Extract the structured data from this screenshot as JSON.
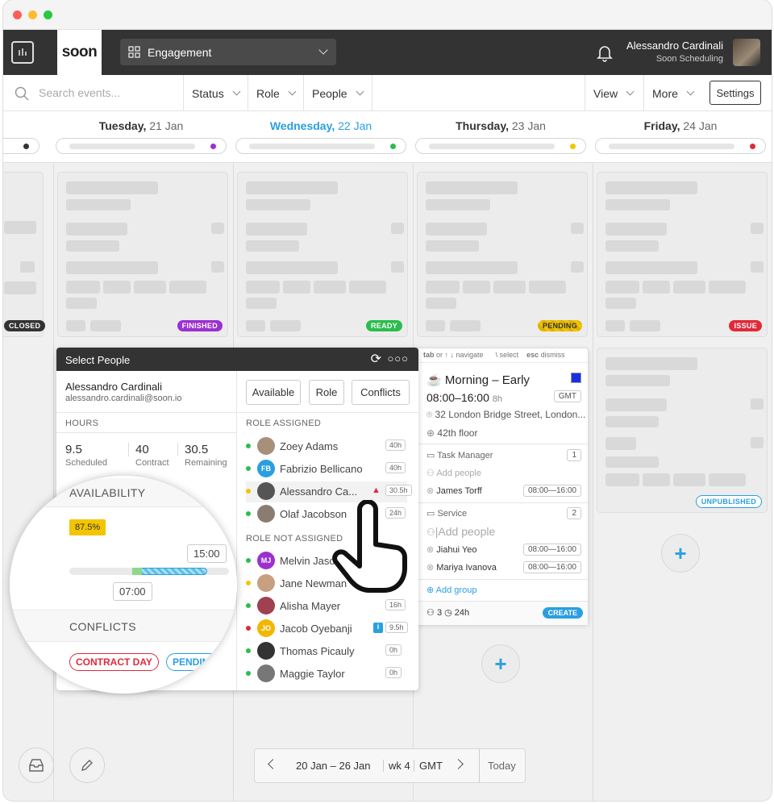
{
  "app": {
    "logo": "soon",
    "workspace": "Engagement",
    "user_name": "Alessandro Cardinali",
    "user_sub": "Soon Scheduling"
  },
  "filters": {
    "search_placeholder": "Search events...",
    "status": "Status",
    "role": "Role",
    "people": "People",
    "view": "View",
    "more": "More",
    "settings": "Settings"
  },
  "days": [
    {
      "name": "Tuesday,",
      "date": "21 Jan",
      "dot": "#9b30d0"
    },
    {
      "name": "Wednesday,",
      "date": "22 Jan",
      "dot": "#2bbd4e"
    },
    {
      "name": "Thursday,",
      "date": "23 Jan",
      "dot": "#f2c500"
    },
    {
      "name": "Friday,",
      "date": "24 Jan",
      "dot": "#e02a3a"
    }
  ],
  "badges": {
    "closed": "CLOSED",
    "finished": "FINISHED",
    "ready": "READY",
    "pending": "PENDING",
    "issue": "ISSUE",
    "unpublished": "UNPUBLISHED"
  },
  "event": {
    "hint_tab": "tab",
    "hint_or": "or ↑ ↓ navigate",
    "hint_select": "\\ select",
    "hint_esc": "esc",
    "hint_dismiss": "dismiss",
    "title": "Morning – Early",
    "time": "08:00–16:00",
    "duration": "8h",
    "tz": "GMT",
    "address": "32 London Bridge Street, London...",
    "floor": "42th floor",
    "group1": {
      "name": "Task Manager",
      "count": "1",
      "add": "Add people",
      "person": "James Torff",
      "time": "08:00—16:00"
    },
    "group2": {
      "name": "Service",
      "count": "2",
      "add": "Add people",
      "p1": "Jiahui Yeo",
      "t1": "08:00—16:00",
      "p2": "Mariya Ivanova",
      "t2": "08:00—16:00"
    },
    "add_group": "Add group",
    "people_count": "3",
    "hours": "24h",
    "create": "CREATE"
  },
  "select_people": {
    "title": "Select People",
    "name": "Alessandro Cardinali",
    "email": "alessandro.cardinali@soon.io",
    "hours_label": "HOURS",
    "scheduled": "9.5",
    "scheduled_label": "Scheduled",
    "contract": "40",
    "contract_label": "Contract",
    "remaining": "30.5",
    "remaining_label": "Remaining",
    "availability_label": "AVAILABILITY",
    "availability_pct": "87.5%",
    "avail_fraction": 0.875,
    "time_end": "15:00",
    "time_start": "07:00",
    "conflicts_label": "CONFLICTS",
    "conflict1": "CONTRACT DAY",
    "conflict2": "PENDING",
    "btn_available": "Available",
    "btn_role": "Role",
    "btn_conflicts": "Conflicts",
    "role_assigned": "ROLE ASSIGNED",
    "role_not_assigned": "ROLE NOT ASSIGNED",
    "assigned": [
      {
        "name": "Zoey Adams",
        "hours": "40h",
        "dot": "#2bbd4e",
        "av": "",
        "avc": "#a88f7a"
      },
      {
        "name": "Fabrizio Bellicano",
        "hours": "40h",
        "dot": "#2bbd4e",
        "av": "FB",
        "avc": "#2a9fe0"
      },
      {
        "name": "Alessandro Ca...",
        "hours": "30.5h",
        "dot": "#f2c500",
        "av": "",
        "avc": "#555"
      },
      {
        "name": "Olaf Jacobson",
        "hours": "24h",
        "dot": "#2bbd4e",
        "av": "",
        "avc": "#8a7c70"
      }
    ],
    "not_assigned": [
      {
        "name": "Melvin Jaso",
        "hours": "",
        "dot": "#2bbd4e",
        "av": "MJ",
        "avc": "#9b30d0"
      },
      {
        "name": "Jane Newman",
        "hours": "",
        "dot": "#f2c500",
        "av": "",
        "avc": "#c8a080"
      },
      {
        "name": "Alisha Mayer",
        "hours": "16h",
        "dot": "#2bbd4e",
        "av": "",
        "avc": "#a04050"
      },
      {
        "name": "Jacob Oyebanji",
        "hours": "9.5h",
        "dot": "#e02a3a",
        "av": "JO",
        "avc": "#f2b800"
      },
      {
        "name": "Thomas Picauly",
        "hours": "0h",
        "dot": "#2bbd4e",
        "av": "",
        "avc": "#333"
      },
      {
        "name": "Maggie Taylor",
        "hours": "0h",
        "dot": "#2bbd4e",
        "av": "",
        "avc": "#777"
      }
    ]
  },
  "nav": {
    "range": "20 Jan – 26 Jan",
    "week": "wk 4",
    "tz": "GMT",
    "today": "Today"
  }
}
